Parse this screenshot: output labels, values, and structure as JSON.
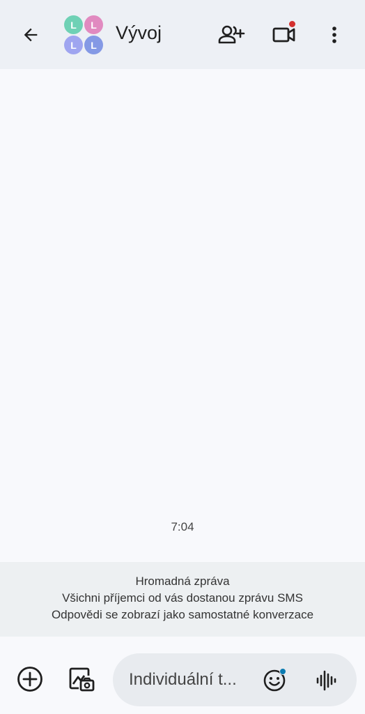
{
  "header": {
    "title": "Vývoj",
    "avatars": [
      {
        "letter": "L",
        "color": "#6fd1b5"
      },
      {
        "letter": "L",
        "color": "#e18ac0"
      },
      {
        "letter": "L",
        "color": "#9fa5f0"
      },
      {
        "letter": "L",
        "color": "#8499e5"
      }
    ],
    "video_notification_color": "#d3302f"
  },
  "conversation": {
    "timestamp": "7:04"
  },
  "group_info": {
    "line1": "Hromadná zpráva",
    "line2": "Všichni příjemci od vás dostanou zprávu SMS",
    "line3": "Odpovědi se zobrazí jako samostatné konverzace"
  },
  "composer": {
    "placeholder": "Individuální t..."
  },
  "icons": {
    "back": "arrow-back-icon",
    "add_person": "add-person-icon",
    "video": "video-call-icon",
    "more": "more-vert-icon",
    "attach": "add-circle-icon",
    "gallery": "gallery-camera-icon",
    "emoji": "emoji-icon",
    "voice": "voice-waveform-icon"
  }
}
